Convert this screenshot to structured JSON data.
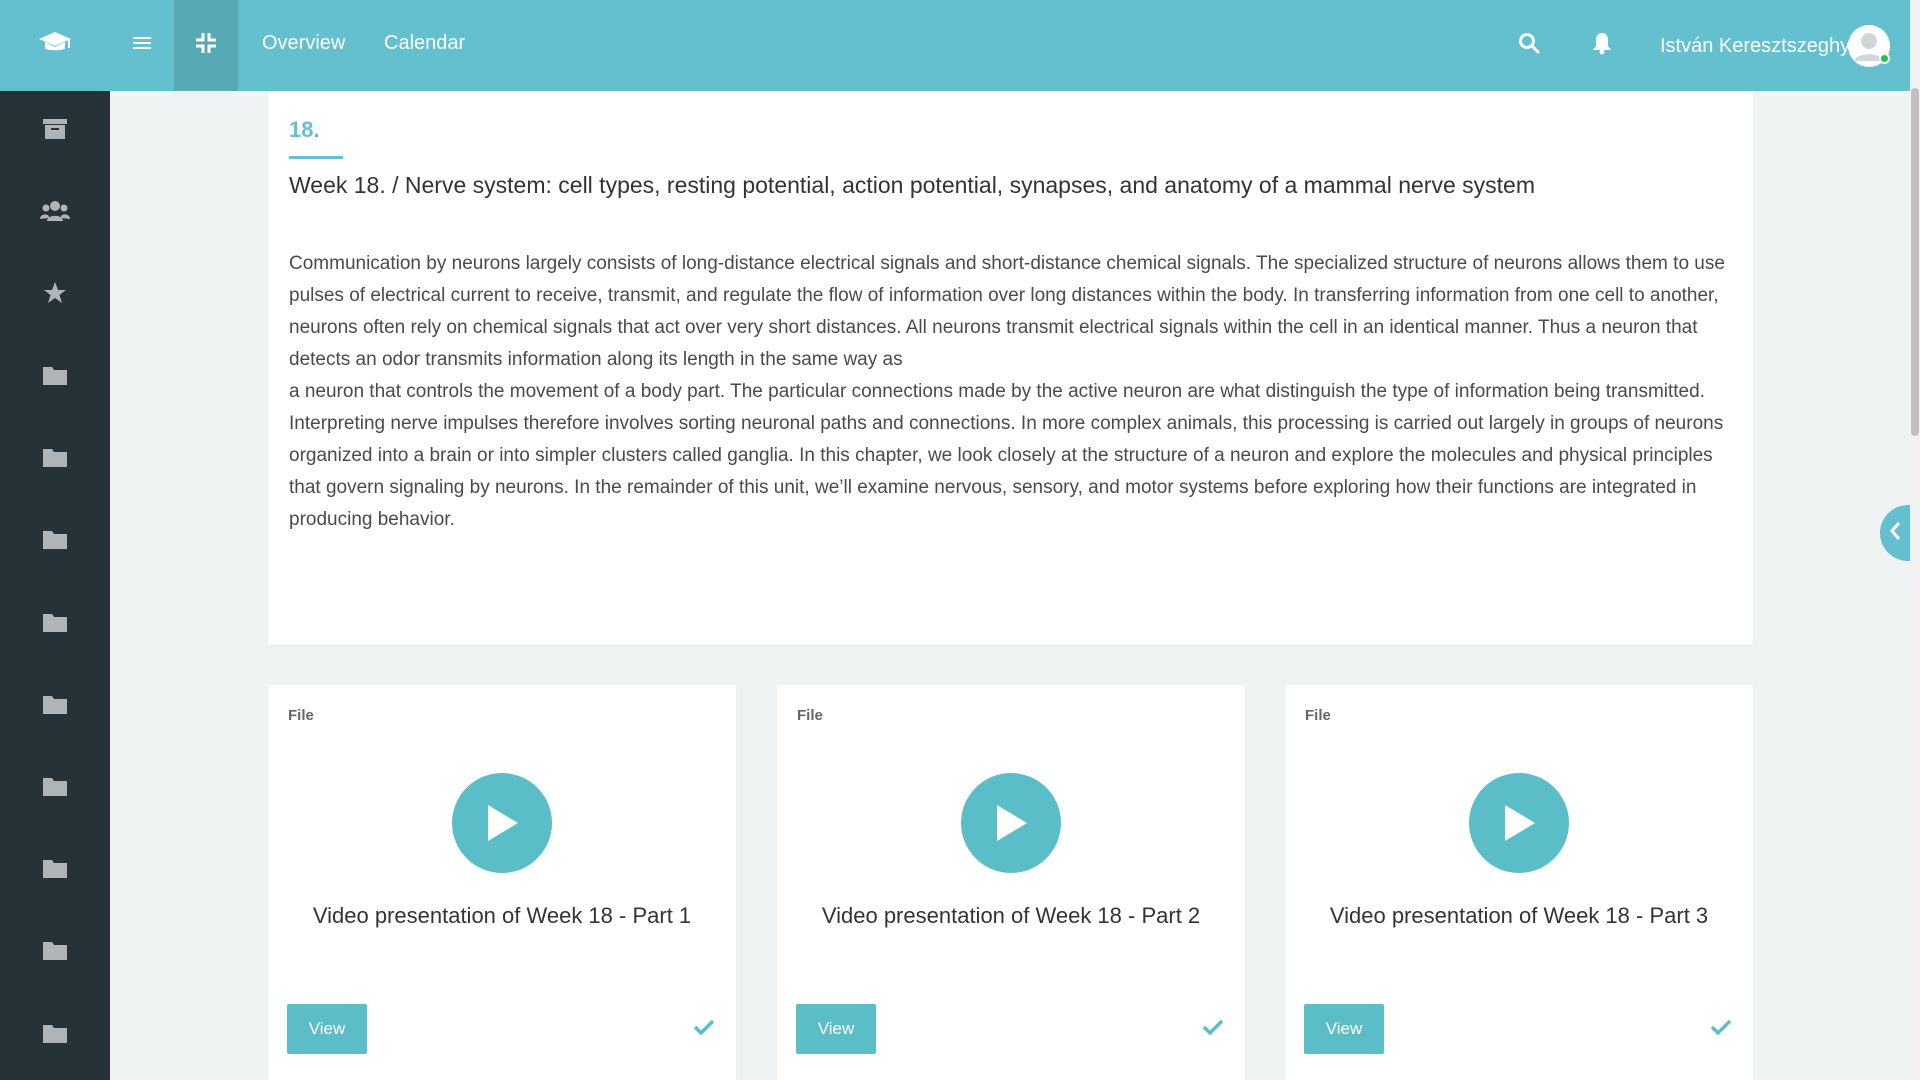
{
  "topbar": {
    "logo_icon": "graduation-cap-icon",
    "menu_icon": "hamburger-menu-icon",
    "shrink_icon": "compress-icon",
    "nav": [
      {
        "label": "Overview"
      },
      {
        "label": "Calendar"
      }
    ],
    "search_icon": "search-icon",
    "bell_icon": "bell-icon",
    "user_name": "István Keresztszeghy",
    "avatar_icon": "user-avatar-icon",
    "status": "online"
  },
  "sidebar": {
    "items": [
      {
        "icon": "archive-icon"
      },
      {
        "icon": "users-icon"
      },
      {
        "icon": "star-icon"
      },
      {
        "icon": "folder-icon"
      },
      {
        "icon": "folder-icon"
      },
      {
        "icon": "folder-icon"
      },
      {
        "icon": "folder-icon"
      },
      {
        "icon": "folder-icon"
      },
      {
        "icon": "folder-icon"
      },
      {
        "icon": "folder-icon"
      },
      {
        "icon": "folder-icon"
      },
      {
        "icon": "folder-icon"
      }
    ]
  },
  "lesson": {
    "number": "18.",
    "title": "Week 18. / Nerve system: cell types, resting potential, action potential, synapses, and anatomy of a mammal nerve system",
    "paragraph1": "Communication by neurons largely consists of long-distance electrical signals and short-distance chemical signals. The specialized structure of neurons allows them to use pulses of electrical current to receive, transmit, and regulate the flow of information over long distances within the body. In transferring information from one cell to another, neurons often rely on chemical signals that act over very short distances. All neurons transmit electrical signals within the cell in an identical manner. Thus a neuron that detects an odor transmits information along its length in the same way as",
    "paragraph2": "a neuron that controls the movement of a body part. The particular connections made by the active neuron are what distinguish the type of information being transmitted. Interpreting nerve impulses therefore involves sorting neuronal paths and connections. In more complex animals, this processing is carried out largely in groups of neurons organized  into a brain or into simpler clusters called ganglia. In this chapter, we look closely at the structure of a neuron and explore the molecules and physical principles that govern signaling by neurons. In the remainder of this unit, we’ll examine nervous, sensory, and motor systems before exploring how their functions are integrated in producing behavior."
  },
  "files": [
    {
      "tag": "File",
      "title": "Video presentation of Week 18 - Part 1",
      "button": "View",
      "completed": true
    },
    {
      "tag": "File",
      "title": "Video presentation of Week 18 - Part 2",
      "button": "View",
      "completed": true
    },
    {
      "tag": "File",
      "title": "Video presentation of Week 18 - Part 3",
      "button": "View",
      "completed": true
    }
  ],
  "right_tab_icon": "chevron-left-icon",
  "colors": {
    "accent": "#64bfce",
    "accent_dark": "#58a9b6",
    "sidebar_bg": "#263238",
    "sidebar_icon": "#aeb4b8",
    "page_bg": "#f0f3f4",
    "button": "#5bbdc8"
  }
}
